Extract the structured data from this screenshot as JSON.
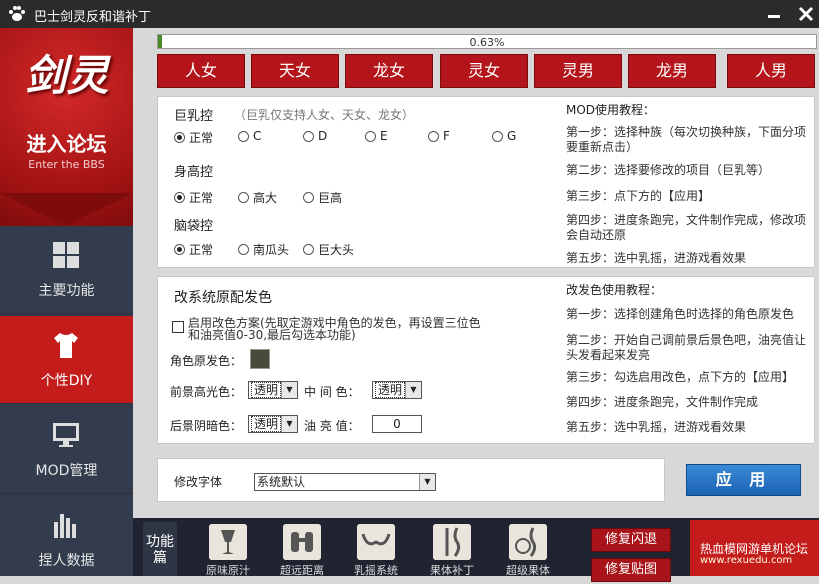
{
  "window": {
    "title": "巴士剑灵反和谐补丁",
    "minimize_icon": "minimize-icon",
    "close_icon": "close-icon"
  },
  "sidebar": {
    "logo_text": "剑灵",
    "forum_label": "进入论坛",
    "forum_sub": "Enter the BBS",
    "items": [
      {
        "label": "主要功能",
        "icon": "grid-icon",
        "active": false
      },
      {
        "label": "个性DIY",
        "icon": "tshirt-icon",
        "active": true
      },
      {
        "label": "MOD管理",
        "icon": "monitor-icon",
        "active": false
      },
      {
        "label": "捏人数据",
        "icon": "bar-chart-icon",
        "active": false
      }
    ]
  },
  "progress": {
    "text": "0.63%",
    "value": 0.0063
  },
  "races": [
    "人女",
    "天女",
    "龙女",
    "灵女",
    "灵男",
    "龙男",
    "人男"
  ],
  "body_panel": {
    "bust": {
      "title": "巨乳控",
      "hint": "（巨乳仅支持人女、天女、龙女）",
      "options": [
        "正常",
        "C",
        "D",
        "E",
        "F",
        "G"
      ],
      "selected": "正常"
    },
    "height": {
      "title": "身高控",
      "options": [
        "正常",
        "高大",
        "巨高"
      ],
      "selected": "正常"
    },
    "head": {
      "title": "脑袋控",
      "options": [
        "正常",
        "南瓜头",
        "巨大头"
      ],
      "selected": "正常"
    },
    "tutorial": {
      "title": "MOD使用教程：",
      "steps": [
        "第一步：选择种族（每次切换种族，下面分项要重新点击）",
        "第二步：选择要修改的项目（巨乳等）",
        "第三步：点下方的【应用】",
        "第四步：进度条跑完，文件制作完成，修改项会自动还原",
        "第五步：选中乳摇，进游戏看效果"
      ]
    }
  },
  "hair_panel": {
    "title": "改系统原配发色",
    "enable_label": "启用改色方案(先取定游戏中角色的发色，再设置三位色和油亮值0-30,最后勾选本功能)",
    "orig_color_label": "角色原发色：",
    "orig_color": "#4a4a3a",
    "fg_label": "前景高光色：",
    "fg_value": "透明",
    "mid_label": "中 间 色：",
    "mid_value": "透明",
    "bg_label": "后景阴暗色：",
    "bg_value": "透明",
    "oil_label": "油 亮 值：",
    "oil_value": "0",
    "tutorial": {
      "title": "改发色使用教程：",
      "steps": [
        "第一步：选择创建角色时选择的角色原发色",
        "第二步：开始自己调前景后景色吧，油亮值让头发看起来发亮",
        "第三步：勾选启用改色，点下方的【应用】",
        "第四步：进度条跑完，文件制作完成",
        "第五步：选中乳摇，进游戏看效果"
      ]
    }
  },
  "font_panel": {
    "label": "修改字体",
    "value": "系统默认"
  },
  "apply_label": "应 用",
  "bottom": {
    "func_label": "功能篇",
    "tools": [
      {
        "label": "原味原汁",
        "icon": "wine-glass-icon"
      },
      {
        "label": "超远距离",
        "icon": "binoculars-icon"
      },
      {
        "label": "乳摇系统",
        "icon": "bra-icon"
      },
      {
        "label": "果体补丁",
        "icon": "body-icon"
      },
      {
        "label": "超级果体",
        "icon": "super-body-icon"
      }
    ],
    "repair_crash": "修复闪退",
    "repair_texture": "修复贴图",
    "watermark": "热血模网游单机论坛",
    "watermark_url": "www.rexuedu.com"
  }
}
